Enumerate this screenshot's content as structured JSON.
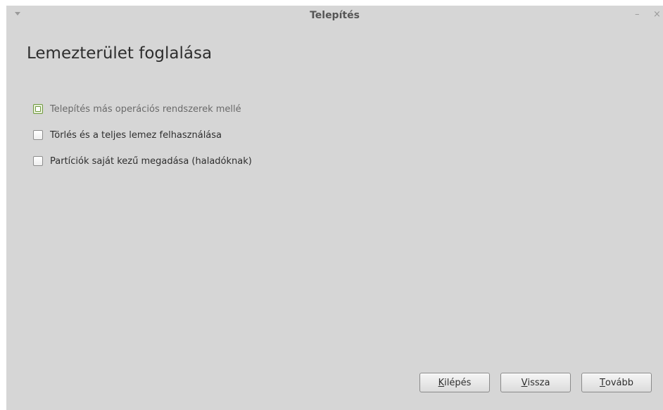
{
  "window": {
    "title": "Telepítés",
    "menu_icon": "chevron-down-icon",
    "minimize_glyph": "–",
    "close_glyph": "×"
  },
  "page": {
    "title": "Lemezterület foglalása"
  },
  "options": [
    {
      "label": "Telepítés más operációs rendszerek mellé",
      "checked": false,
      "focused": true
    },
    {
      "label": "Törlés és a teljes lemez felhasználása",
      "checked": false,
      "focused": false
    },
    {
      "label": "Partíciók saját kezű megadása (haladóknak)",
      "checked": false,
      "focused": false
    }
  ],
  "buttons": {
    "quit": {
      "mnemonic": "K",
      "rest": "ilépés"
    },
    "back": {
      "mnemonic": "V",
      "rest": "issza"
    },
    "next": {
      "mnemonic": "T",
      "rest": "ovább"
    }
  },
  "colors": {
    "background": "#d6d6d6",
    "focus_accent": "#6f9a3f",
    "text": "#2e2e2e"
  }
}
